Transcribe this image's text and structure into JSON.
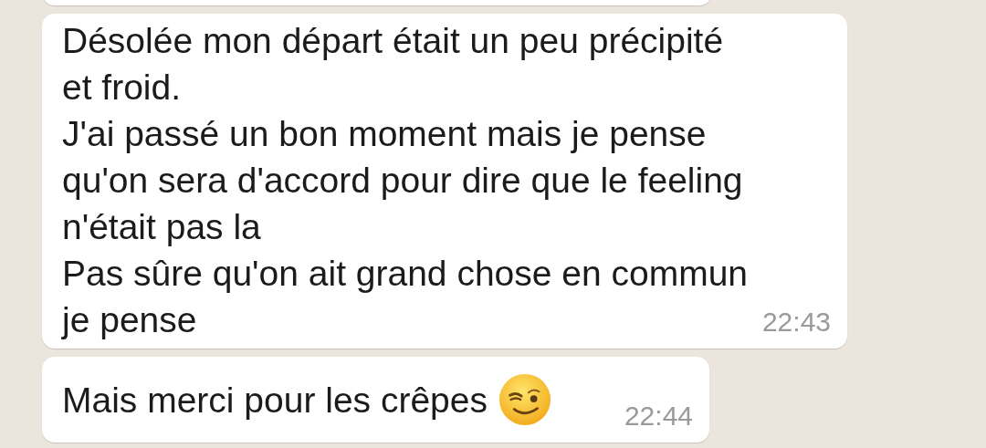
{
  "messages": [
    {
      "kind": "cut_off"
    },
    {
      "kind": "text",
      "text": "Désolée mon départ était un peu précipité\net froid.\nJ'ai passé un bon moment mais je pense\nqu'on sera d'accord pour dire que le feeling\nn'était pas la\nPas sûre qu'on ait grand chose en commun\nje pense",
      "time": "22:43"
    },
    {
      "kind": "text_with_emoji",
      "text": "Mais merci pour les crêpes",
      "time": "22:44"
    }
  ]
}
